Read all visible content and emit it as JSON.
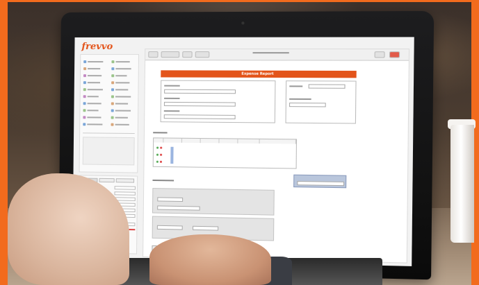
{
  "app": {
    "logo_text": "frevvo",
    "brand_color": "#e3541a",
    "form_title": "Expense Report"
  },
  "colors": {
    "frame_orange": "#f26b1d",
    "laptop_bezel": "#141414"
  },
  "icons": [
    "checkbox-icon",
    "status-dot-icon"
  ]
}
